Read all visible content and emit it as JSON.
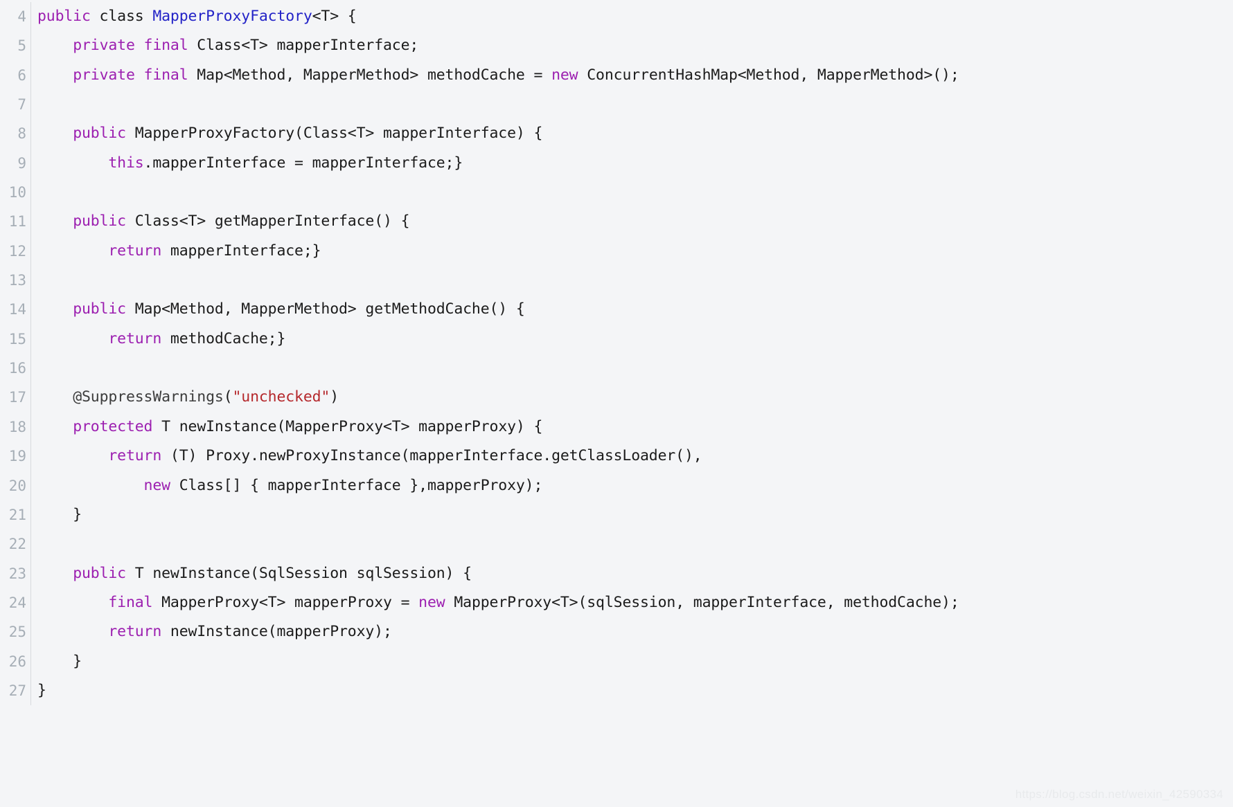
{
  "editor": {
    "language": "java",
    "background_color": "#f4f5f7",
    "gutter_color": "#a6aeb6",
    "first_line_number": 4,
    "last_line_number": 27,
    "theme_colors": {
      "keyword": "#9c1fb0",
      "class_name": "#2323c7",
      "string": "#b5282c",
      "annotation": "#3c3c3c",
      "plain": "#1b1b1b"
    }
  },
  "watermark": {
    "text": "https://blog.csdn.net/weixin_42590334"
  },
  "lines": [
    {
      "n": "4",
      "tokens": [
        {
          "t": "public",
          "c": "kw"
        },
        {
          "t": " class ",
          "c": "pl"
        },
        {
          "t": "MapperProxyFactory",
          "c": "cls"
        },
        {
          "t": "<T> {",
          "c": "pl"
        }
      ]
    },
    {
      "n": "5",
      "tokens": [
        {
          "t": "    ",
          "c": "pl"
        },
        {
          "t": "private final",
          "c": "kw"
        },
        {
          "t": " Class<T> mapperInterface;",
          "c": "pl"
        }
      ]
    },
    {
      "n": "6",
      "tokens": [
        {
          "t": "    ",
          "c": "pl"
        },
        {
          "t": "private final",
          "c": "kw"
        },
        {
          "t": " Map<Method, MapperMethod> methodCache = ",
          "c": "pl"
        },
        {
          "t": "new",
          "c": "kw"
        },
        {
          "t": " ConcurrentHashMap<Method, MapperMethod>();",
          "c": "pl"
        }
      ]
    },
    {
      "n": "7",
      "tokens": []
    },
    {
      "n": "8",
      "tokens": [
        {
          "t": "    ",
          "c": "pl"
        },
        {
          "t": "public",
          "c": "kw"
        },
        {
          "t": " MapperProxyFactory(Class<T> mapperInterface) {",
          "c": "pl"
        }
      ]
    },
    {
      "n": "9",
      "tokens": [
        {
          "t": "        ",
          "c": "pl"
        },
        {
          "t": "this",
          "c": "kw"
        },
        {
          "t": ".mapperInterface = mapperInterface;}",
          "c": "pl"
        }
      ]
    },
    {
      "n": "10",
      "tokens": []
    },
    {
      "n": "11",
      "tokens": [
        {
          "t": "    ",
          "c": "pl"
        },
        {
          "t": "public",
          "c": "kw"
        },
        {
          "t": " Class<T> getMapperInterface() {",
          "c": "pl"
        }
      ]
    },
    {
      "n": "12",
      "tokens": [
        {
          "t": "        ",
          "c": "pl"
        },
        {
          "t": "return",
          "c": "kw"
        },
        {
          "t": " mapperInterface;}",
          "c": "pl"
        }
      ]
    },
    {
      "n": "13",
      "tokens": []
    },
    {
      "n": "14",
      "tokens": [
        {
          "t": "    ",
          "c": "pl"
        },
        {
          "t": "public",
          "c": "kw"
        },
        {
          "t": " Map<Method, MapperMethod> getMethodCache() {",
          "c": "pl"
        }
      ]
    },
    {
      "n": "15",
      "tokens": [
        {
          "t": "        ",
          "c": "pl"
        },
        {
          "t": "return",
          "c": "kw"
        },
        {
          "t": " methodCache;}",
          "c": "pl"
        }
      ]
    },
    {
      "n": "16",
      "tokens": []
    },
    {
      "n": "17",
      "tokens": [
        {
          "t": "    ",
          "c": "pl"
        },
        {
          "t": "@SuppressWarnings",
          "c": "ann"
        },
        {
          "t": "(",
          "c": "pl"
        },
        {
          "t": "\"unchecked\"",
          "c": "str"
        },
        {
          "t": ")",
          "c": "pl"
        }
      ]
    },
    {
      "n": "18",
      "tokens": [
        {
          "t": "    ",
          "c": "pl"
        },
        {
          "t": "protected",
          "c": "kw"
        },
        {
          "t": " T newInstance(MapperProxy<T> mapperProxy) {",
          "c": "pl"
        }
      ]
    },
    {
      "n": "19",
      "tokens": [
        {
          "t": "        ",
          "c": "pl"
        },
        {
          "t": "return",
          "c": "kw"
        },
        {
          "t": " (T) Proxy.newProxyInstance(mapperInterface.getClassLoader(),",
          "c": "pl"
        }
      ]
    },
    {
      "n": "20",
      "tokens": [
        {
          "t": "            ",
          "c": "pl"
        },
        {
          "t": "new",
          "c": "kw"
        },
        {
          "t": " Class[] { mapperInterface },mapperProxy);",
          "c": "pl"
        }
      ]
    },
    {
      "n": "21",
      "tokens": [
        {
          "t": "    }",
          "c": "pl"
        }
      ]
    },
    {
      "n": "22",
      "tokens": []
    },
    {
      "n": "23",
      "tokens": [
        {
          "t": "    ",
          "c": "pl"
        },
        {
          "t": "public",
          "c": "kw"
        },
        {
          "t": " T newInstance(SqlSession sqlSession) {",
          "c": "pl"
        }
      ]
    },
    {
      "n": "24",
      "tokens": [
        {
          "t": "        ",
          "c": "pl"
        },
        {
          "t": "final",
          "c": "kw"
        },
        {
          "t": " MapperProxy<T> mapperProxy = ",
          "c": "pl"
        },
        {
          "t": "new",
          "c": "kw"
        },
        {
          "t": " MapperProxy<T>(sqlSession, mapperInterface, methodCache);",
          "c": "pl"
        }
      ]
    },
    {
      "n": "25",
      "tokens": [
        {
          "t": "        ",
          "c": "pl"
        },
        {
          "t": "return",
          "c": "kw"
        },
        {
          "t": " newInstance(mapperProxy);",
          "c": "pl"
        }
      ]
    },
    {
      "n": "26",
      "tokens": [
        {
          "t": "    }",
          "c": "pl"
        }
      ]
    },
    {
      "n": "27",
      "tokens": [
        {
          "t": "}",
          "c": "pl"
        }
      ]
    }
  ]
}
